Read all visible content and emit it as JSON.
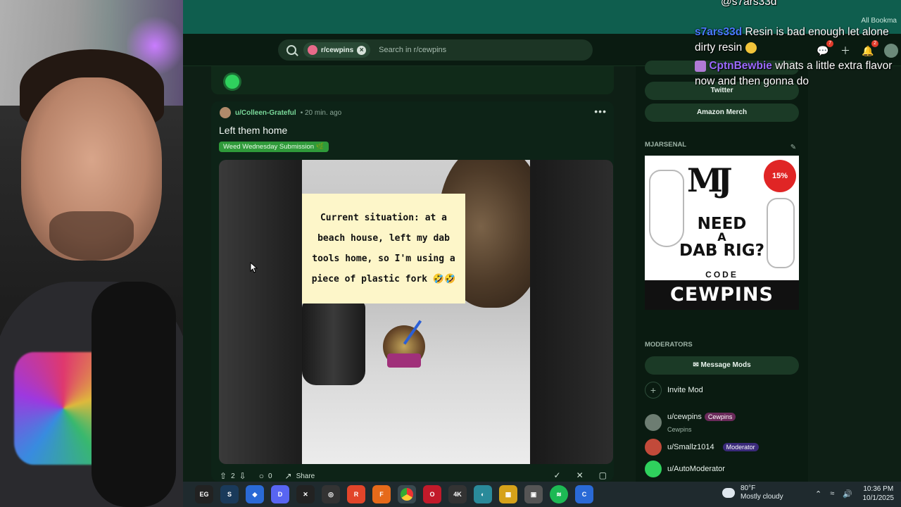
{
  "browser": {
    "bookmarks_label": "All Bookma",
    "search_chip": "r/cewpins",
    "search_placeholder": "Search in r/cewpins",
    "chat_badge": "7",
    "notif_badge": "2"
  },
  "post": {
    "author": "u/Colleen-Grateful",
    "time": "• 20 min. ago",
    "title": "Left them home",
    "flair": "Weed Wednesday Submission 🌿",
    "caption": "Current situation: at a beach house, left my dab tools home, so I'm using a piece of plastic fork 🤣🤣",
    "votes": "2",
    "comments": "0",
    "share_label": "Share"
  },
  "sidebar": {
    "twitter_label": "Twitter",
    "amazon_label": "Amazon Merch",
    "mjarsenal_label": "MJARSENAL",
    "ad": {
      "logo": "MJ",
      "discount": "15% OFF",
      "line1": "NEED",
      "line2": "A",
      "line3": "DAB RIG?",
      "code_label": "CODE",
      "code": "CEWPINS"
    },
    "moderators_label": "MODERATORS",
    "message_mods": "Message Mods",
    "invite_mod": "Invite Mod",
    "mods": [
      {
        "name": "u/cewpins",
        "flair": "Cewpins",
        "sub": "Cewpins"
      },
      {
        "name": "u/Smallz1014",
        "flair": "Moderator",
        "sub": ""
      },
      {
        "name": "u/AutoModerator",
        "flair": "",
        "sub": ""
      }
    ]
  },
  "chat": {
    "top_partial": "@s7ars33d",
    "msg1_user": "s7ars33d",
    "msg1_text": "Resin is bad enough let alone dirty resin",
    "msg2_user": "CptnBewbie",
    "msg2_text": "whats a little extra flavor now and then gonna do"
  },
  "taskbar": {
    "apps": [
      "epic-games",
      "steam",
      "app-3",
      "discord",
      "app-5",
      "app-6",
      "app-7",
      "firefox",
      "chrome",
      "opera",
      "app-11",
      "app-12",
      "app-13",
      "camera",
      "spotify",
      "app-16"
    ],
    "weather_temp": "80°F",
    "weather_desc": "Mostly cloudy",
    "time": "10:36 PM",
    "date": "10/1/2025"
  },
  "colors": {
    "accent": "#7ad99a",
    "topbar": "#0f5e4e",
    "flair": "#2f9a3a"
  }
}
